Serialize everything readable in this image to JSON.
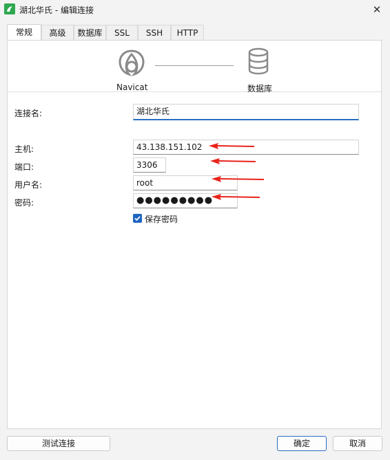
{
  "window": {
    "title": "湖北华氏 - 编辑连接",
    "close_glyph": "✕"
  },
  "tabs": [
    {
      "label": "常规",
      "active": true
    },
    {
      "label": "高级"
    },
    {
      "label": "数据库"
    },
    {
      "label": "SSL"
    },
    {
      "label": "SSH"
    },
    {
      "label": "HTTP"
    }
  ],
  "header": {
    "left_label": "Navicat",
    "right_label": "数据库"
  },
  "form": {
    "connection_name": {
      "label": "连接名:",
      "value": "湖北华氏"
    },
    "host": {
      "label": "主机:",
      "value": "43.138.151.102"
    },
    "port": {
      "label": "端口:",
      "value": "3306"
    },
    "username": {
      "label": "用户名:",
      "value": "root"
    },
    "password": {
      "label": "密码:",
      "value": "●●●●●●●●●"
    },
    "save_password": {
      "label": "保存密码",
      "checked": true
    }
  },
  "buttons": {
    "test": "测试连接",
    "ok": "确定",
    "cancel": "取消"
  },
  "colors": {
    "accent": "#2b6cc4",
    "annotation_arrow": "#e8231b",
    "app_icon": "#2fa84f"
  }
}
